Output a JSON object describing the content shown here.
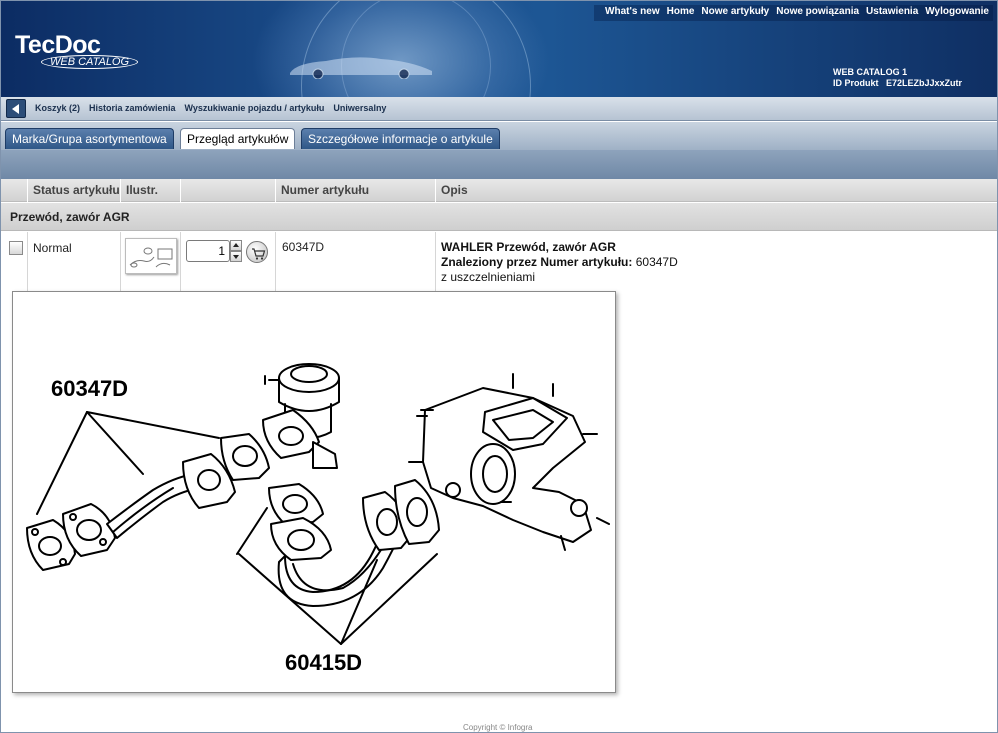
{
  "header": {
    "logo_brand": "TecDoc",
    "logo_sub": "WEB CATALOG",
    "top_nav": [
      "What's new",
      "Home",
      "Nowe artykuły",
      "Nowe powiązania",
      "Ustawienia",
      "Wylogowanie"
    ],
    "catalog_line1": "WEB CATALOG 1",
    "catalog_line2": "ID Produkt   E72LEZbJJxxZutr"
  },
  "subnav": {
    "links": [
      "Koszyk (2)",
      "Historia zamówienia",
      "Wyszukiwanie pojazdu / artykułu",
      "Uniwersalny"
    ]
  },
  "tabs": [
    {
      "label": "Marka/Grupa asortymentowa",
      "active": false
    },
    {
      "label": "Przegląd artykułów",
      "active": true
    },
    {
      "label": "Szczegółowe informacje o artykule",
      "active": false
    }
  ],
  "table": {
    "columns": [
      "Status artykułu",
      "Ilustr.",
      "",
      "Numer artykułu",
      "Opis"
    ],
    "group": "Przewód, zawór AGR",
    "row": {
      "status": "Normal",
      "quantity": "1",
      "article_number": "60347D",
      "desc_title": "WAHLER Przewód, zawór AGR",
      "desc_found_label": "Znaleziony przez Numer artykułu:",
      "desc_found_value": "60347D",
      "desc_note": "z uszczelnieniami"
    }
  },
  "illustration": {
    "label_top": "60347D",
    "label_bottom": "60415D"
  },
  "footer": "Copyright © Infogra"
}
